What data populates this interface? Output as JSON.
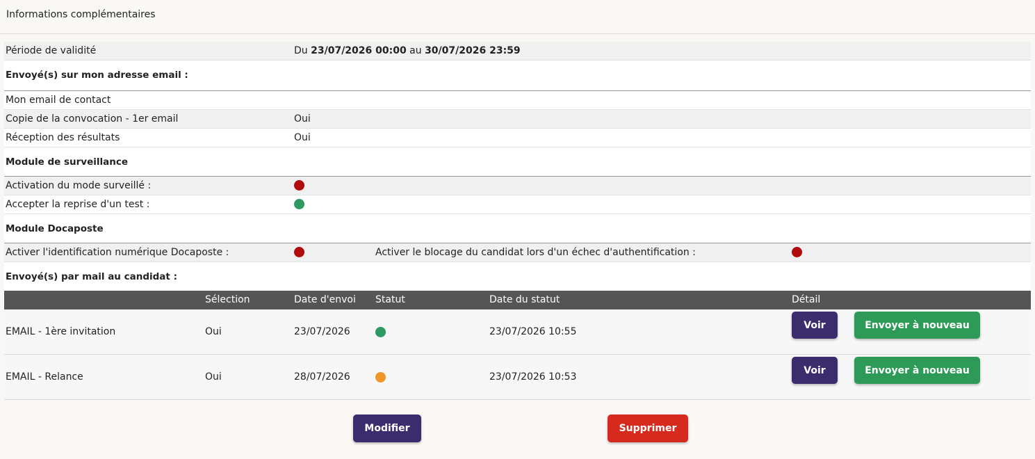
{
  "header": {
    "title": "Informations complémentaires"
  },
  "validity": {
    "label": "Période de validité",
    "prefix": "Du",
    "start": "23/07/2026 00:00",
    "middle": "au",
    "end": "30/07/2026 23:59"
  },
  "email_section": {
    "title": "Envoyé(s) sur mon adresse email :",
    "rows": [
      {
        "label": "Mon email de contact",
        "value": ""
      },
      {
        "label": "Copie de la convocation - 1er email",
        "value": "Oui"
      },
      {
        "label": "Réception des résultats",
        "value": "Oui"
      }
    ]
  },
  "surveillance": {
    "title": "Module de surveillance",
    "rows": [
      {
        "label": "Activation du mode surveillé :",
        "status": "red"
      },
      {
        "label": "Accepter la reprise d'un test :",
        "status": "green"
      }
    ]
  },
  "docaposte": {
    "title": "Module Docaposte",
    "identification_label": "Activer l'identification numérique Docaposte :",
    "identification_status": "red",
    "blocking_label": "Activer le blocage du candidat lors d'un échec d'authentification :",
    "blocking_status": "red"
  },
  "candidate_mail": {
    "title": "Envoyé(s) par mail au candidat :",
    "columns": {
      "name": "",
      "selection": "Sélection",
      "date_sent": "Date d'envoi",
      "status": "Statut",
      "status_date": "Date du statut",
      "detail": "Détail"
    },
    "rows": [
      {
        "name": "EMAIL - 1ère invitation",
        "selection": "Oui",
        "date_sent": "23/07/2026",
        "status": "green",
        "status_date": "23/07/2026 10:55",
        "view_label": "Voir",
        "resend_label": "Envoyer à nouveau"
      },
      {
        "name": "EMAIL - Relance",
        "selection": "Oui",
        "date_sent": "28/07/2026",
        "status": "orange",
        "status_date": "23/07/2026 10:53",
        "view_label": "Voir",
        "resend_label": "Envoyer à nouveau"
      }
    ]
  },
  "actions": {
    "modify_label": "Modifier",
    "delete_label": "Supprimer"
  },
  "colors": {
    "red": "#b00b0b",
    "green": "#2d9a63",
    "orange": "#f0952a",
    "purple_button": "#3b2c6e",
    "green_button": "#2e9a58",
    "red_button": "#d62a1e",
    "table_header": "#555555"
  }
}
